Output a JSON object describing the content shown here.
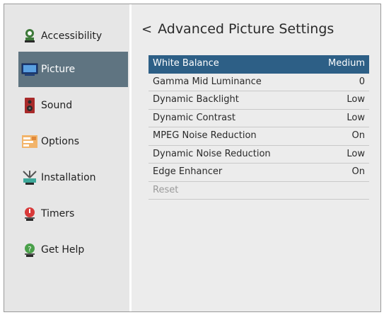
{
  "sidebar": {
    "items": [
      {
        "label": "Accessibility",
        "icon": "accessibility-icon"
      },
      {
        "label": "Picture",
        "icon": "tv-icon",
        "active": true
      },
      {
        "label": "Sound",
        "icon": "speaker-icon"
      },
      {
        "label": "Options",
        "icon": "options-icon"
      },
      {
        "label": "Installation",
        "icon": "antenna-icon"
      },
      {
        "label": "Timers",
        "icon": "timer-icon"
      },
      {
        "label": "Get Help",
        "icon": "help-icon"
      }
    ]
  },
  "main": {
    "back_glyph": "<",
    "title": "Advanced Picture Settings",
    "settings": [
      {
        "label": "White Balance",
        "value": "Medium"
      },
      {
        "label": "Gamma Mid Luminance",
        "value": "0"
      },
      {
        "label": "Dynamic Backlight",
        "value": "Low"
      },
      {
        "label": "Dynamic Contrast",
        "value": "Low"
      },
      {
        "label": "MPEG Noise Reduction",
        "value": "On"
      },
      {
        "label": "Dynamic Noise Reduction",
        "value": "Low"
      },
      {
        "label": "Edge Enhancer",
        "value": "On"
      },
      {
        "label": "Reset",
        "value": ""
      }
    ]
  },
  "colors": {
    "selected_row": "#2d5f86",
    "active_nav": "#5f7481"
  }
}
